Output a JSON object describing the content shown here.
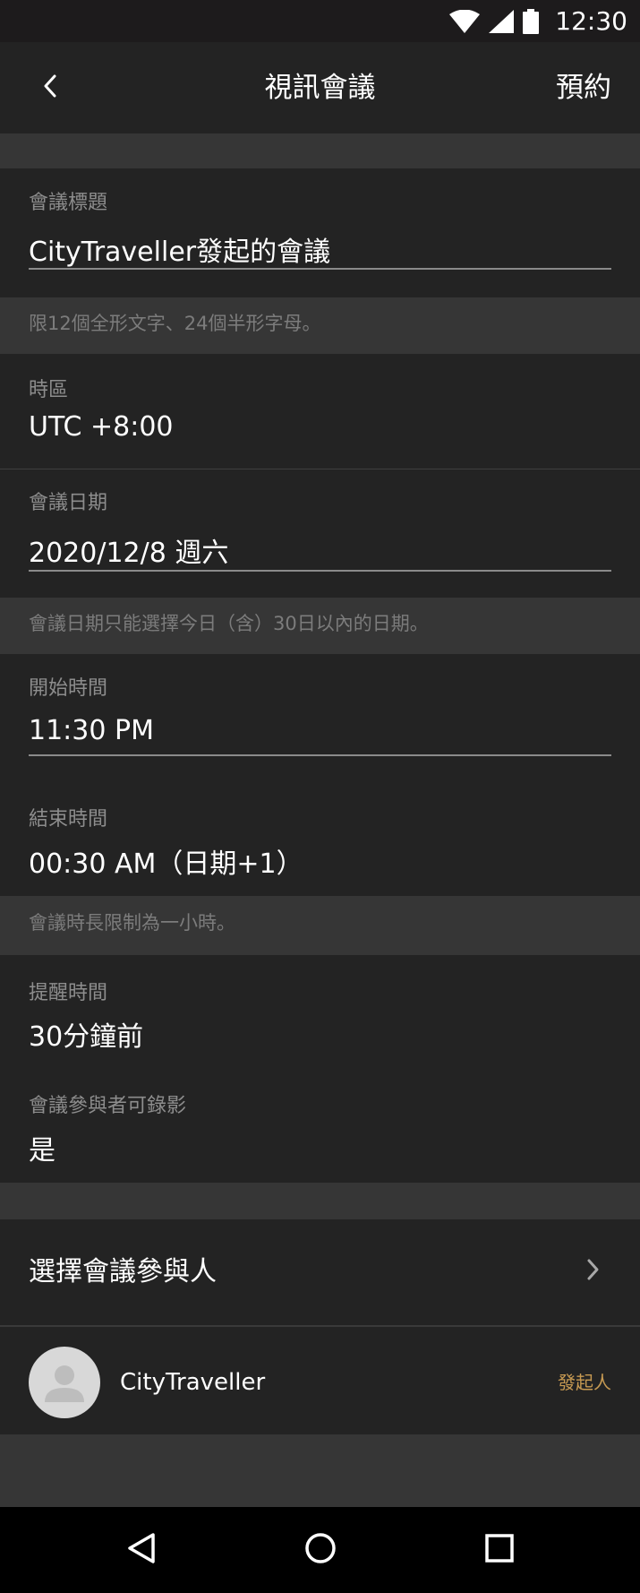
{
  "status_bar": {
    "time": "12:30",
    "icons": [
      "wifi-icon",
      "cellular-signal-icon",
      "battery-icon"
    ]
  },
  "app_bar": {
    "back_icon": "chevron-left-icon",
    "title": "視訊會議",
    "action_label": "預約"
  },
  "form": {
    "title_field": {
      "label": "會議標題",
      "value": "CityTraveller發起的會議",
      "hint": "限12個全形文字、24個半形字母。"
    },
    "timezone": {
      "label": "時區",
      "value": "UTC +8:00"
    },
    "date": {
      "label": "會議日期",
      "value": "2020/12/8 週六",
      "hint": "會議日期只能選擇今日（含）30日以內的日期。"
    },
    "start_time": {
      "label": "開始時間",
      "value": "11:30 PM"
    },
    "end_time": {
      "label": "結束時間",
      "value": "00:30 AM（日期+1）",
      "hint": "會議時長限制為一小時。"
    },
    "reminder": {
      "label": "提醒時間",
      "value": "30分鐘前"
    },
    "recording": {
      "label": "會議參與者可錄影",
      "value": "是"
    }
  },
  "participants": {
    "select_label": "選擇會議參與人",
    "members": [
      {
        "name": "CityTraveller",
        "role": "發起人"
      }
    ]
  },
  "colors": {
    "background": "#363636",
    "surface": "#232323",
    "text_primary": "#ffffff",
    "text_secondary": "#8d8d8d",
    "accent_role": "#c79a52"
  },
  "nav_bar": {
    "icons": [
      "back-triangle-icon",
      "home-circle-icon",
      "recents-square-icon"
    ]
  }
}
